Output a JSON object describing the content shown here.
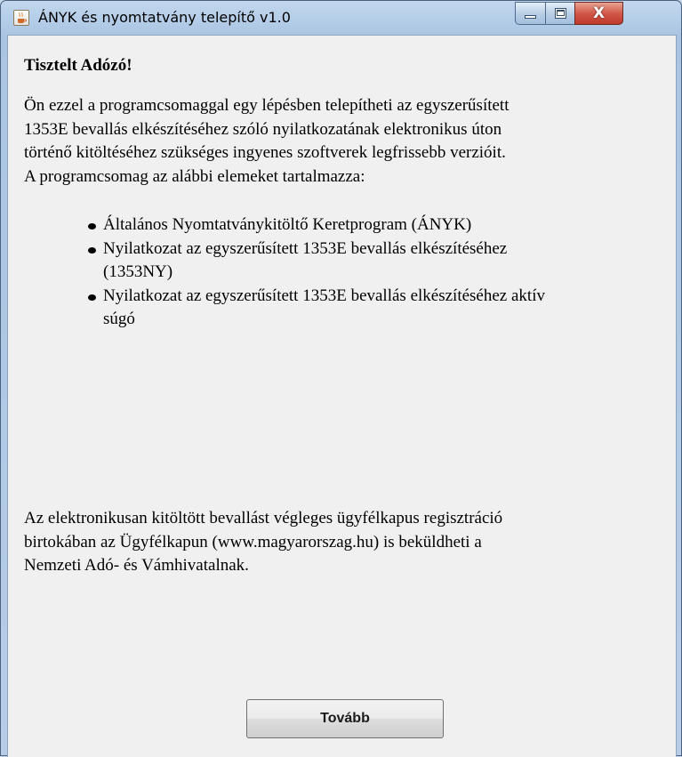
{
  "window": {
    "title": "ÁNYK és nyomtatvány telepítő v1.0",
    "icon": "java-cup-icon",
    "controls": {
      "minimize": "minimize-icon",
      "maximize": "maximize-icon",
      "close": "close-icon",
      "close_glyph": "X"
    }
  },
  "content": {
    "greeting": "Tisztelt Adózó!",
    "intro_lines": [
      "Ön ezzel a programcsomaggal egy lépésben telepítheti az egyszerűsített",
      "1353E bevallás elkészítéséhez szóló nyilatkozatának elektronikus úton",
      "történő kitöltéséhez szükséges ingyenes szoftverek legfrissebb verzióit.",
      "A programcsomag az alábbi elemeket tartalmazza:"
    ],
    "items": [
      {
        "lines": [
          "Általános Nyomtatványkitöltő Keretprogram (ÁNYK)"
        ]
      },
      {
        "lines": [
          "Nyilatkozat az egyszerűsített 1353E bevallás elkészítéséhez",
          "(1353NY)"
        ]
      },
      {
        "lines": [
          "Nyilatkozat az egyszerűsített 1353E bevallás elkészítéséhez aktív",
          "súgó"
        ]
      }
    ],
    "outro_lines": [
      "Az elektronikusan kitöltött bevallást végleges ügyfélkapus regisztráció",
      "birtokában az Ügyfélkapun (www.magyarorszag.hu) is beküldheti a",
      "Nemzeti Adó- és Vámhivatalnak."
    ]
  },
  "buttons": {
    "next_label": "Tovább"
  },
  "colors": {
    "title_bar": "#b6cde8",
    "client_bg": "#f0f0f0",
    "close_btn": "#c9463a"
  }
}
